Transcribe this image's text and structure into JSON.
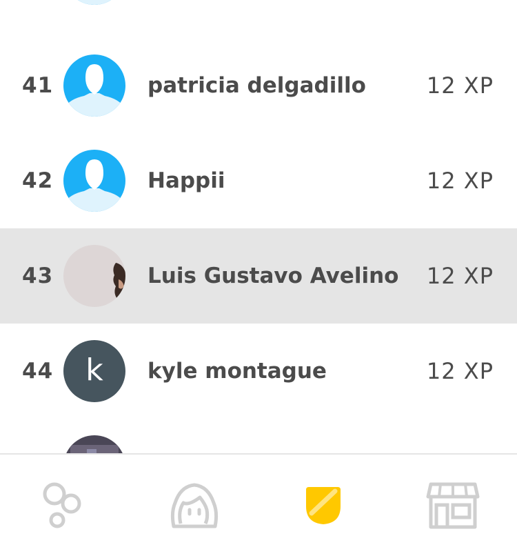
{
  "leaderboard": {
    "rows": [
      {
        "rank": "",
        "name": "",
        "xp": ""
      },
      {
        "rank": "41",
        "name": "patricia delgadillo",
        "xp": "12 XP"
      },
      {
        "rank": "42",
        "name": "Happii",
        "xp": "12 XP"
      },
      {
        "rank": "43",
        "name": "Luis Gustavo Avelino",
        "xp": "12 XP",
        "highlighted": true
      },
      {
        "rank": "44",
        "name": "kyle montague",
        "xp": "12 XP",
        "avatar_letter": "k"
      }
    ]
  },
  "tabbar": {
    "tabs": [
      {
        "icon": "learn-circles-icon",
        "active": false
      },
      {
        "icon": "profile-face-icon",
        "active": false
      },
      {
        "icon": "leaderboard-shield-icon",
        "active": true
      },
      {
        "icon": "shop-icon",
        "active": false
      }
    ]
  },
  "colors": {
    "default_avatar_bg": "#1cb0f6",
    "highlight_row": "#e5e5e5",
    "text": "#4b4b4b",
    "letter_avatar_bg": "#46555e",
    "active_tab_yellow": "#ffc800",
    "inactive_icon": "#cfcfcf"
  }
}
